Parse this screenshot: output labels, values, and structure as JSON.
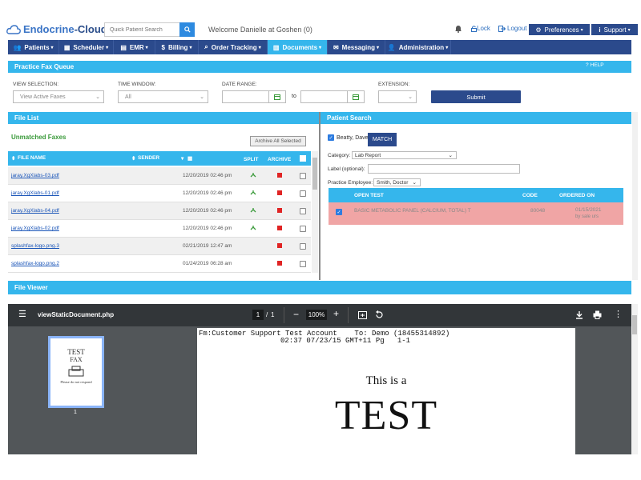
{
  "header": {
    "logo_part1": "Endocrine",
    "logo_part2": "-Cloud",
    "search_placeholder": "Quick Patient Search",
    "welcome": "Welcome Danielle at Goshen (0)",
    "lock": "Lock",
    "logout": "Logout",
    "preferences": "Preferences",
    "support": "Support"
  },
  "nav": {
    "items": [
      {
        "label": "Patients",
        "icon": "users-icon"
      },
      {
        "label": "Scheduler",
        "icon": "calendar-icon"
      },
      {
        "label": "EMR",
        "icon": "folder-icon"
      },
      {
        "label": "Billing",
        "icon": "dollar-icon"
      },
      {
        "label": "Order Tracking",
        "icon": "search-icon"
      },
      {
        "label": "Documents",
        "icon": "document-icon"
      },
      {
        "label": "Messaging",
        "icon": "envelope-icon"
      },
      {
        "label": "Administration",
        "icon": "user-icon"
      }
    ],
    "active": "Documents"
  },
  "fax_queue": {
    "title": "Practice Fax Queue",
    "help": "HELP",
    "view_selection_label": "VIEW SELECTION:",
    "view_selection_value": "View Active Faxes",
    "time_window_label": "TIME WINDOW:",
    "time_window_value": "All",
    "date_range_label": "DATE RANGE:",
    "to_label": "to",
    "extension_label": "EXTENSION:",
    "extension_value": "",
    "submit": "Submit"
  },
  "file_list": {
    "title": "File List",
    "subtitle": "Unmatched Faxes",
    "archive_all": "Archive All Selected",
    "columns": {
      "file_name": "FILE NAME",
      "sender": "SENDER",
      "split": "SPLIT",
      "archive": "ARCHIVE"
    },
    "rows": [
      {
        "name": "jaray.XgXlabs-03.pdf",
        "date": "12/20/2019 02:46 pm",
        "split": true
      },
      {
        "name": "jaray.XgXlabs-01.pdf",
        "date": "12/20/2019 02:46 pm",
        "split": true
      },
      {
        "name": "jaray.XgXlabs-04.pdf",
        "date": "12/20/2019 02:46 pm",
        "split": true
      },
      {
        "name": "jaray.XgXlabs-02.pdf",
        "date": "12/20/2019 02:46 pm",
        "split": true
      },
      {
        "name": "splashfax-logo.png.3",
        "date": "02/21/2019 12:47 am",
        "split": false
      },
      {
        "name": "splashfax-logo.png.2",
        "date": "01/24/2019 06:28 am",
        "split": false
      }
    ]
  },
  "patient_search": {
    "title": "Patient Search",
    "patient": "Beatty, Dave",
    "match": "MATCH",
    "category_label": "Category:",
    "category_value": "Lab Report",
    "label_label": "Label (optional):",
    "employee_label": "Practice Employee:",
    "employee_value": "Smith, Doctor",
    "columns": {
      "open_test": "OPEN TEST",
      "code": "CODE",
      "ordered_on": "ORDERED ON"
    },
    "test": {
      "name": "BASIC METABOLIC PANEL (CALCIUM, TOTAL) T",
      "code": "80048",
      "date": "01/15/2021",
      "by": "by sale urs"
    }
  },
  "file_viewer": {
    "title": "File Viewer",
    "doc_name": "viewStaticDocument.php",
    "page_current": "1",
    "page_sep": "/",
    "page_total": "1",
    "zoom": "100%",
    "thumb_number": "1",
    "thumb_lines": [
      "TEST",
      "FAX",
      "Please do not respond"
    ],
    "fax_header_line1": "Fm:Customer Support Test Account    To: Demo (18455314892)",
    "fax_header_line2": "02:37 07/23/15 GMT+11 Pg   1-1",
    "body_line1": "This is a",
    "body_line2": "TEST"
  },
  "colors": {
    "brand": "#2b4a8c",
    "accent": "#35b6ec",
    "highlight_row": "#f0a5a5",
    "archive_red": "#e02424"
  }
}
